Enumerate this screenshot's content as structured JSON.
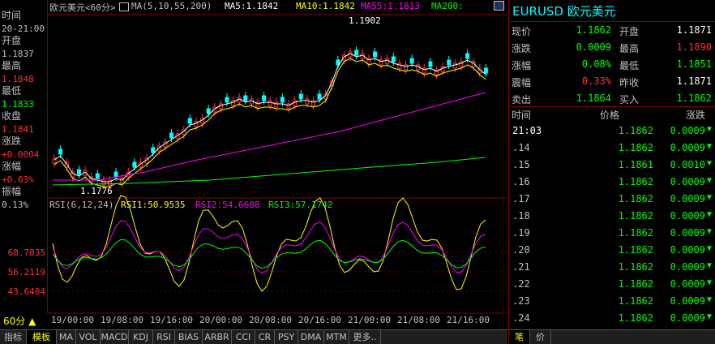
{
  "left_info": {
    "rows": [
      {
        "label": "时间",
        "value": "20-21:00",
        "color": "#c0c0c0"
      },
      {
        "label": "开盘",
        "value": "1.1837",
        "color": "#c0c0c0"
      },
      {
        "label": "最高",
        "value": "1.1848",
        "color": "#ff3232"
      },
      {
        "label": "最低",
        "value": "1.1833",
        "color": "#00ff00"
      },
      {
        "label": "收盘",
        "value": "1.1841",
        "color": "#ff3232"
      },
      {
        "label": "涨跌",
        "value": "+0.0004",
        "color": "#ff3232"
      },
      {
        "label": "涨幅",
        "value": "+0.03%",
        "color": "#ff3232"
      },
      {
        "label": "振幅",
        "value": "0.13%",
        "color": "#c0c0c0"
      }
    ],
    "period": "60分 ▲"
  },
  "legend": {
    "name": "欧元美元<60分>",
    "ma_icon": "chart-settings-icon",
    "ma": "MA(5,10,55,200)",
    "ma5": "MA5:1.1842",
    "ma10": "MA10:1.1842",
    "ma55": "MA55:1.1813",
    "ma200": "MA200:",
    "colors": {
      "ma5": "#ffffff",
      "ma10": "#ffff00",
      "ma55": "#ff00ff",
      "ma200": "#00ff00"
    }
  },
  "rsi_legend": {
    "name": "RSI(6,12,24)",
    "rsi1": "RSI1:50.9535",
    "rsi2": "RSI2:54.6688",
    "rsi3": "RSI3:57.1742"
  },
  "price_annotations": {
    "high": "1.1902",
    "low": "1.1776"
  },
  "y_labels": [
    "68.7835",
    "56.2119",
    "43.6404"
  ],
  "x_labels": [
    "19/00:00",
    "19/08:00",
    "19/16:00",
    "20/00:00",
    "20/08:00",
    "20/16:00",
    "21/00:00",
    "21/08:00",
    "21/16:00"
  ],
  "tabs": [
    "指标",
    "模板",
    "MA",
    "VOL",
    "MACD",
    "KDJ",
    "RSI",
    "BIAS",
    "ARBR",
    "CCI",
    "CR",
    "PSY",
    "DMA",
    "MTM",
    "更多.."
  ],
  "right_panel": {
    "title": "EURUSD 欧元美元",
    "quote": [
      {
        "l1": "现价",
        "v1": "1.1862",
        "c1": "#00ff00",
        "l2": "开盘",
        "v2": "1.1871",
        "c2": "#ffffff"
      },
      {
        "l1": "涨跌",
        "v1": "0.0009",
        "c1": "#00ff00",
        "l2": "最高",
        "v2": "1.1890",
        "c2": "#ff3232"
      },
      {
        "l1": "涨幅",
        "v1": "0.08%",
        "c1": "#00ff00",
        "l2": "最低",
        "v2": "1.1851",
        "c2": "#00ff00"
      },
      {
        "l1": "震幅",
        "v1": "0.33%",
        "c1": "#ff3232",
        "l2": "昨收",
        "v2": "1.1871",
        "c2": "#ffffff"
      },
      {
        "l1": "卖出",
        "v1": "1.1864",
        "c1": "#00ff00",
        "l2": "买入",
        "v2": "1.1862",
        "c2": "#00ff00"
      }
    ],
    "tick_headers": {
      "time": "时间",
      "price": "价格",
      "change": "涨跌"
    },
    "ticks": [
      {
        "time": "21:03",
        "price": "1.1862",
        "change": "0.0009"
      },
      {
        "time": ".14",
        "price": "1.1862",
        "change": "0.0009"
      },
      {
        "time": ".15",
        "price": "1.1861",
        "change": "0.0010"
      },
      {
        "time": ".16",
        "price": "1.1862",
        "change": "0.0009"
      },
      {
        "time": ".17",
        "price": "1.1862",
        "change": "0.0009"
      },
      {
        "time": ".18",
        "price": "1.1862",
        "change": "0.0009"
      },
      {
        "time": ".19",
        "price": "1.1862",
        "change": "0.0009"
      },
      {
        "time": ".20",
        "price": "1.1862",
        "change": "0.0009"
      },
      {
        "time": ".21",
        "price": "1.1862",
        "change": "0.0009"
      },
      {
        "time": ".22",
        "price": "1.1862",
        "change": "0.0009"
      },
      {
        "time": ".23",
        "price": "1.1862",
        "change": "0.0009"
      },
      {
        "time": ".24",
        "price": "1.1862",
        "change": "0.0009"
      }
    ],
    "tabs": [
      "笔",
      "价"
    ]
  }
}
